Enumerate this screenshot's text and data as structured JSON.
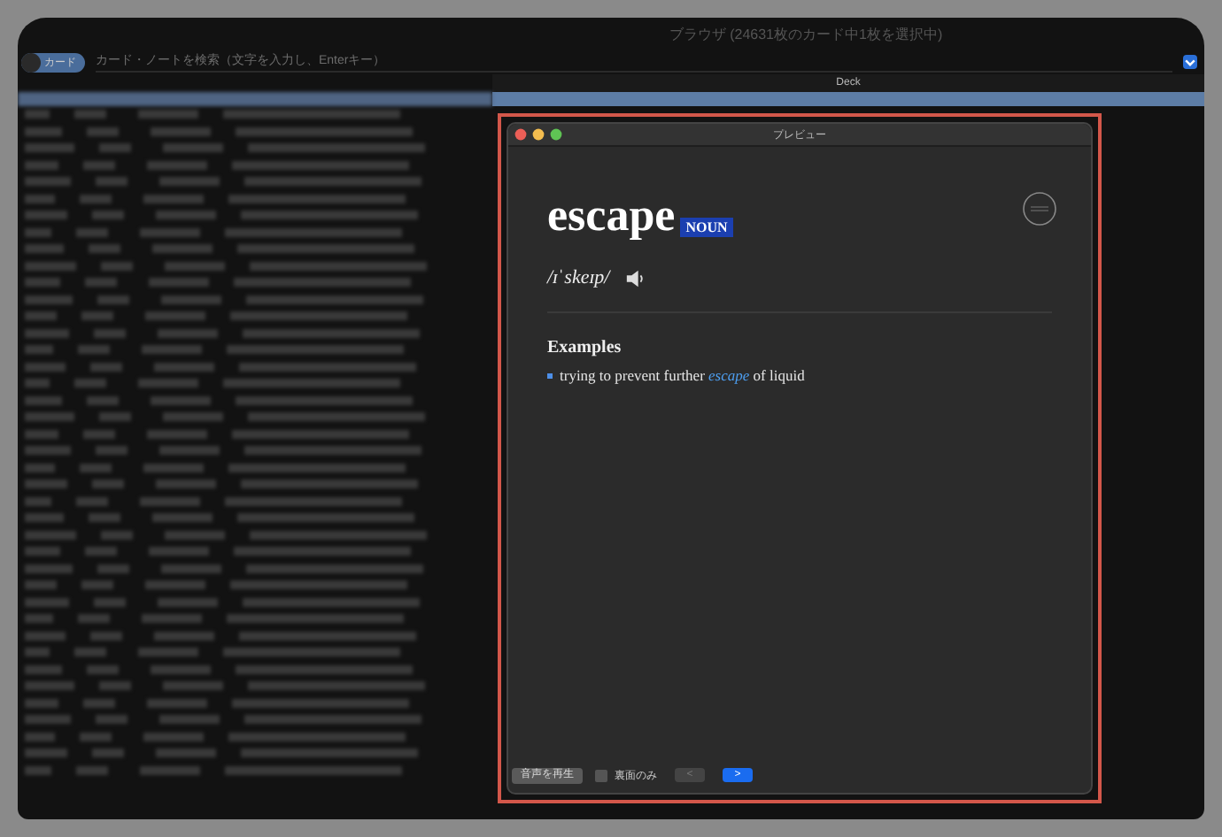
{
  "window": {
    "title": "ブラウザ (24631枚のカード中1枚を選択中)"
  },
  "search": {
    "mode_toggle": {
      "label": "カード",
      "on": true
    },
    "placeholder": "カード・ノートを検索（文字を入力し、Enterキー）",
    "option_checked": true
  },
  "table": {
    "columns": [
      "Deck"
    ]
  },
  "preview": {
    "title": "プレビュー",
    "word": "escape",
    "part_of_speech": "NOUN",
    "pronunciation": "/ɪˈskeɪp/",
    "section_heading": "Examples",
    "examples": [
      "trying to prevent further *escape* of liquid"
    ],
    "play_audio_button": "音声を再生",
    "back_only": {
      "label": "裏面のみ",
      "checked": false
    },
    "prev_button": {
      "label": "<",
      "disabled": true
    },
    "next_button": {
      "label": ">",
      "disabled": false
    }
  }
}
